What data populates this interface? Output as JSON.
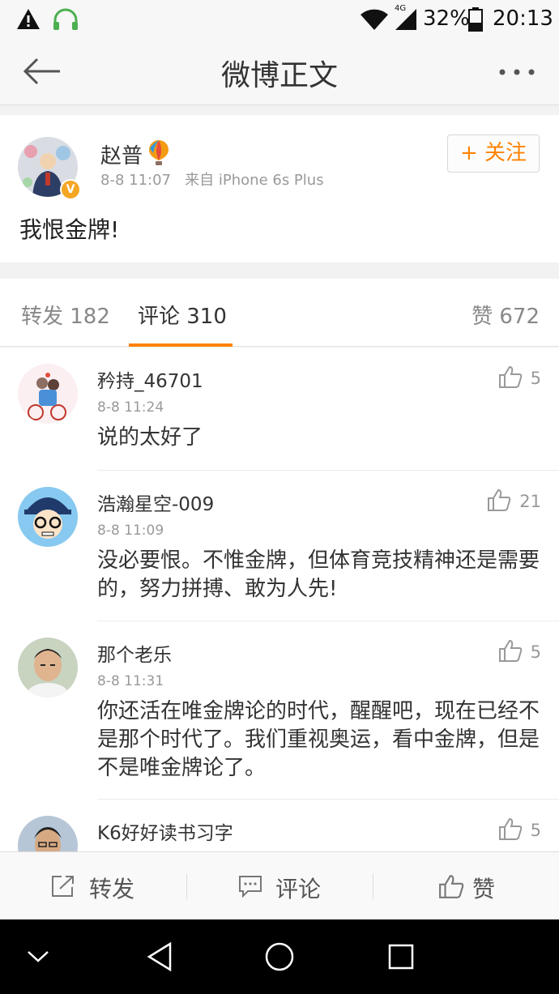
{
  "status_bar": {
    "icons": [
      "warning-icon",
      "headphones-icon",
      "wifi-icon",
      "signal-icon",
      "battery-icon"
    ],
    "network": "4G",
    "battery": "32%",
    "time": "20:13"
  },
  "nav": {
    "title": "微博正文",
    "back_icon": "back-arrow-icon",
    "more_icon": "more-icon"
  },
  "post": {
    "author": "赵普",
    "time": "8-8 11:07",
    "source": "来自 iPhone 6s Plus",
    "follow_label": "+ 关注",
    "text": "我恨金牌!"
  },
  "tabs": {
    "repost": "转发 182",
    "comments": "评论 310",
    "likes": "赞 672"
  },
  "comments": [
    {
      "name": "矜持_46701",
      "time": "8-8 11:24",
      "text": "说的太好了",
      "likes": "5"
    },
    {
      "name": "浩瀚星空-009",
      "time": "8-8 11:09",
      "text": "没必要恨。不惟金牌，但体育竞技精神还是需要的，努力拼搏、敢为人先!",
      "likes": "21"
    },
    {
      "name": "那个老乐",
      "time": "8-8 11:31",
      "text": "你还活在唯金牌论的时代，醒醒吧，现在已经不是那个时代了。我们重视奥运，看中金牌，但是不是唯金牌论了。",
      "likes": "5"
    },
    {
      "name": "K6好好读书习字",
      "time": "",
      "text": "",
      "likes": "5"
    }
  ],
  "actions": {
    "repost": "转发",
    "comment": "评论",
    "like": "赞"
  },
  "colors": {
    "accent": "#ff8200",
    "verified_badge": "#f5a623"
  }
}
